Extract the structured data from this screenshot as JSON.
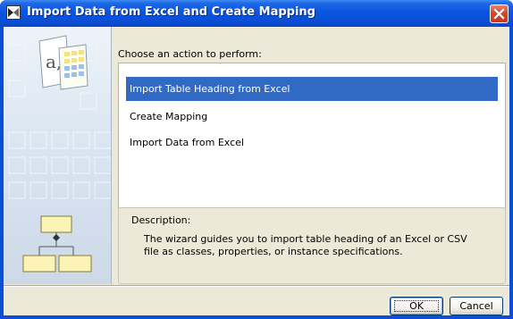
{
  "window": {
    "title": "Import Data from Excel and Create Mapping"
  },
  "heading": "Choose an action to perform:",
  "actions": [
    {
      "label": "Import Table Heading from Excel",
      "selected": true
    },
    {
      "label": "Create Mapping",
      "selected": false
    },
    {
      "label": "Import Data from Excel",
      "selected": false
    }
  ],
  "description": {
    "label": "Description:",
    "text": "The wizard guides you to import table heading of an Excel or CSV file as classes, properties, or instance specifications."
  },
  "buttons": {
    "ok": "OK",
    "cancel": "Cancel"
  },
  "art": {
    "letter_glyph": "a,"
  },
  "colors": {
    "title_bar": "#0a55e0",
    "selection": "#316ac5",
    "close_button": "#d6452a",
    "art_background": "#d9e6f3"
  }
}
